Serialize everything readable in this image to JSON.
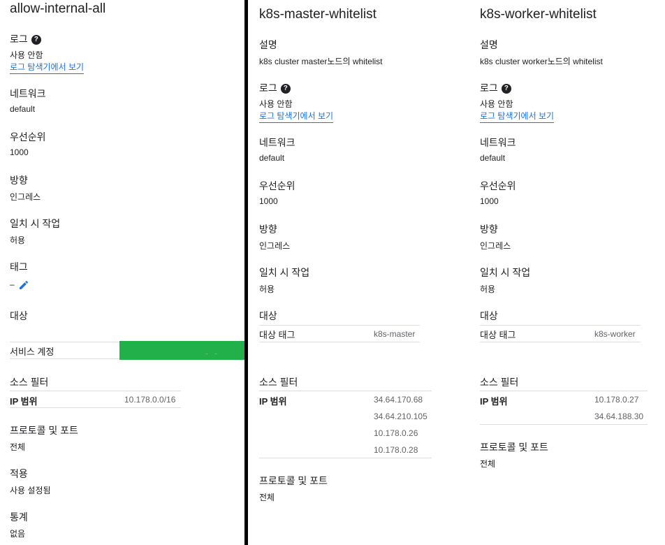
{
  "colors": {
    "link": "#1a73e8",
    "divider": "#000000",
    "highlight_green": "#22b04b"
  },
  "panel1": {
    "title": "allow-internal-all",
    "log_label": "로그",
    "log_value": "사용 안함",
    "log_link": "로그 탐색기에서 보기",
    "network_label": "네트워크",
    "network_value": "default",
    "priority_label": "우선순위",
    "priority_value": "1000",
    "direction_label": "방향",
    "direction_value": "인그레스",
    "action_label": "일치 시 작업",
    "action_value": "허용",
    "tags_label": "태그",
    "tags_value": "–",
    "target_label": "대상",
    "service_account_label": "서비스 계정",
    "source_filter_label": "소스 필터",
    "ip_range_label": "IP 범위",
    "ip_ranges": [
      "10.178.0.0/16"
    ],
    "protocol_label": "프로토콜 및 포트",
    "protocol_value": "전체",
    "enforcement_label": "적용",
    "enforcement_value": "사용 설정됨",
    "stats_label": "통계",
    "stats_value": "없음"
  },
  "panel2": {
    "title": "k8s-master-whitelist",
    "desc_label": "설명",
    "desc_value": "k8s cluster master노드의 whitelist",
    "log_label": "로그",
    "log_value": "사용 안함",
    "log_link": "로그 탐색기에서 보기",
    "network_label": "네트워크",
    "network_value": "default",
    "priority_label": "우선순위",
    "priority_value": "1000",
    "direction_label": "방향",
    "direction_value": "인그레스",
    "action_label": "일치 시 작업",
    "action_value": "허용",
    "target_label": "대상",
    "target_tag_label": "대상 태그",
    "target_tag_value": "k8s-master",
    "source_filter_label": "소스 필터",
    "ip_range_label": "IP 범위",
    "ip_ranges": [
      "34.64.170.68",
      "34.64.210.105",
      "10.178.0.26",
      "10.178.0.28"
    ],
    "protocol_label": "프로토콜 및 포트",
    "protocol_value": "전체"
  },
  "panel3": {
    "title": "k8s-worker-whitelist",
    "desc_label": "설명",
    "desc_value": "k8s cluster worker노드의 whitelist",
    "log_label": "로그",
    "log_value": "사용 안함",
    "log_link": "로그 탐색기에서 보기",
    "network_label": "네트워크",
    "network_value": "default",
    "priority_label": "우선순위",
    "priority_value": "1000",
    "direction_label": "방향",
    "direction_value": "인그레스",
    "action_label": "일치 시 작업",
    "action_value": "허용",
    "target_label": "대상",
    "target_tag_label": "대상 태그",
    "target_tag_value": "k8s-worker",
    "source_filter_label": "소스 필터",
    "ip_range_label": "IP 범위",
    "ip_ranges": [
      "10.178.0.27",
      "34.64.188.30"
    ],
    "protocol_label": "프로토콜 및 포트",
    "protocol_value": "전체"
  }
}
